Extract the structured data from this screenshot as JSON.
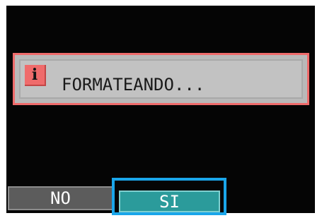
{
  "dialog": {
    "icon": "info-icon",
    "icon_glyph": "i",
    "message": "FORMATEANDO..."
  },
  "buttons": {
    "no_label": "NO",
    "si_label": "SI"
  },
  "colors": {
    "screen_bg": "#050505",
    "dialog_border": "#ef6b6b",
    "dialog_bg": "#c2c2c2",
    "selected_button": "#2b9b9b",
    "selection_highlight": "#1aa6ea",
    "unselected_button": "#5c5c5c"
  }
}
